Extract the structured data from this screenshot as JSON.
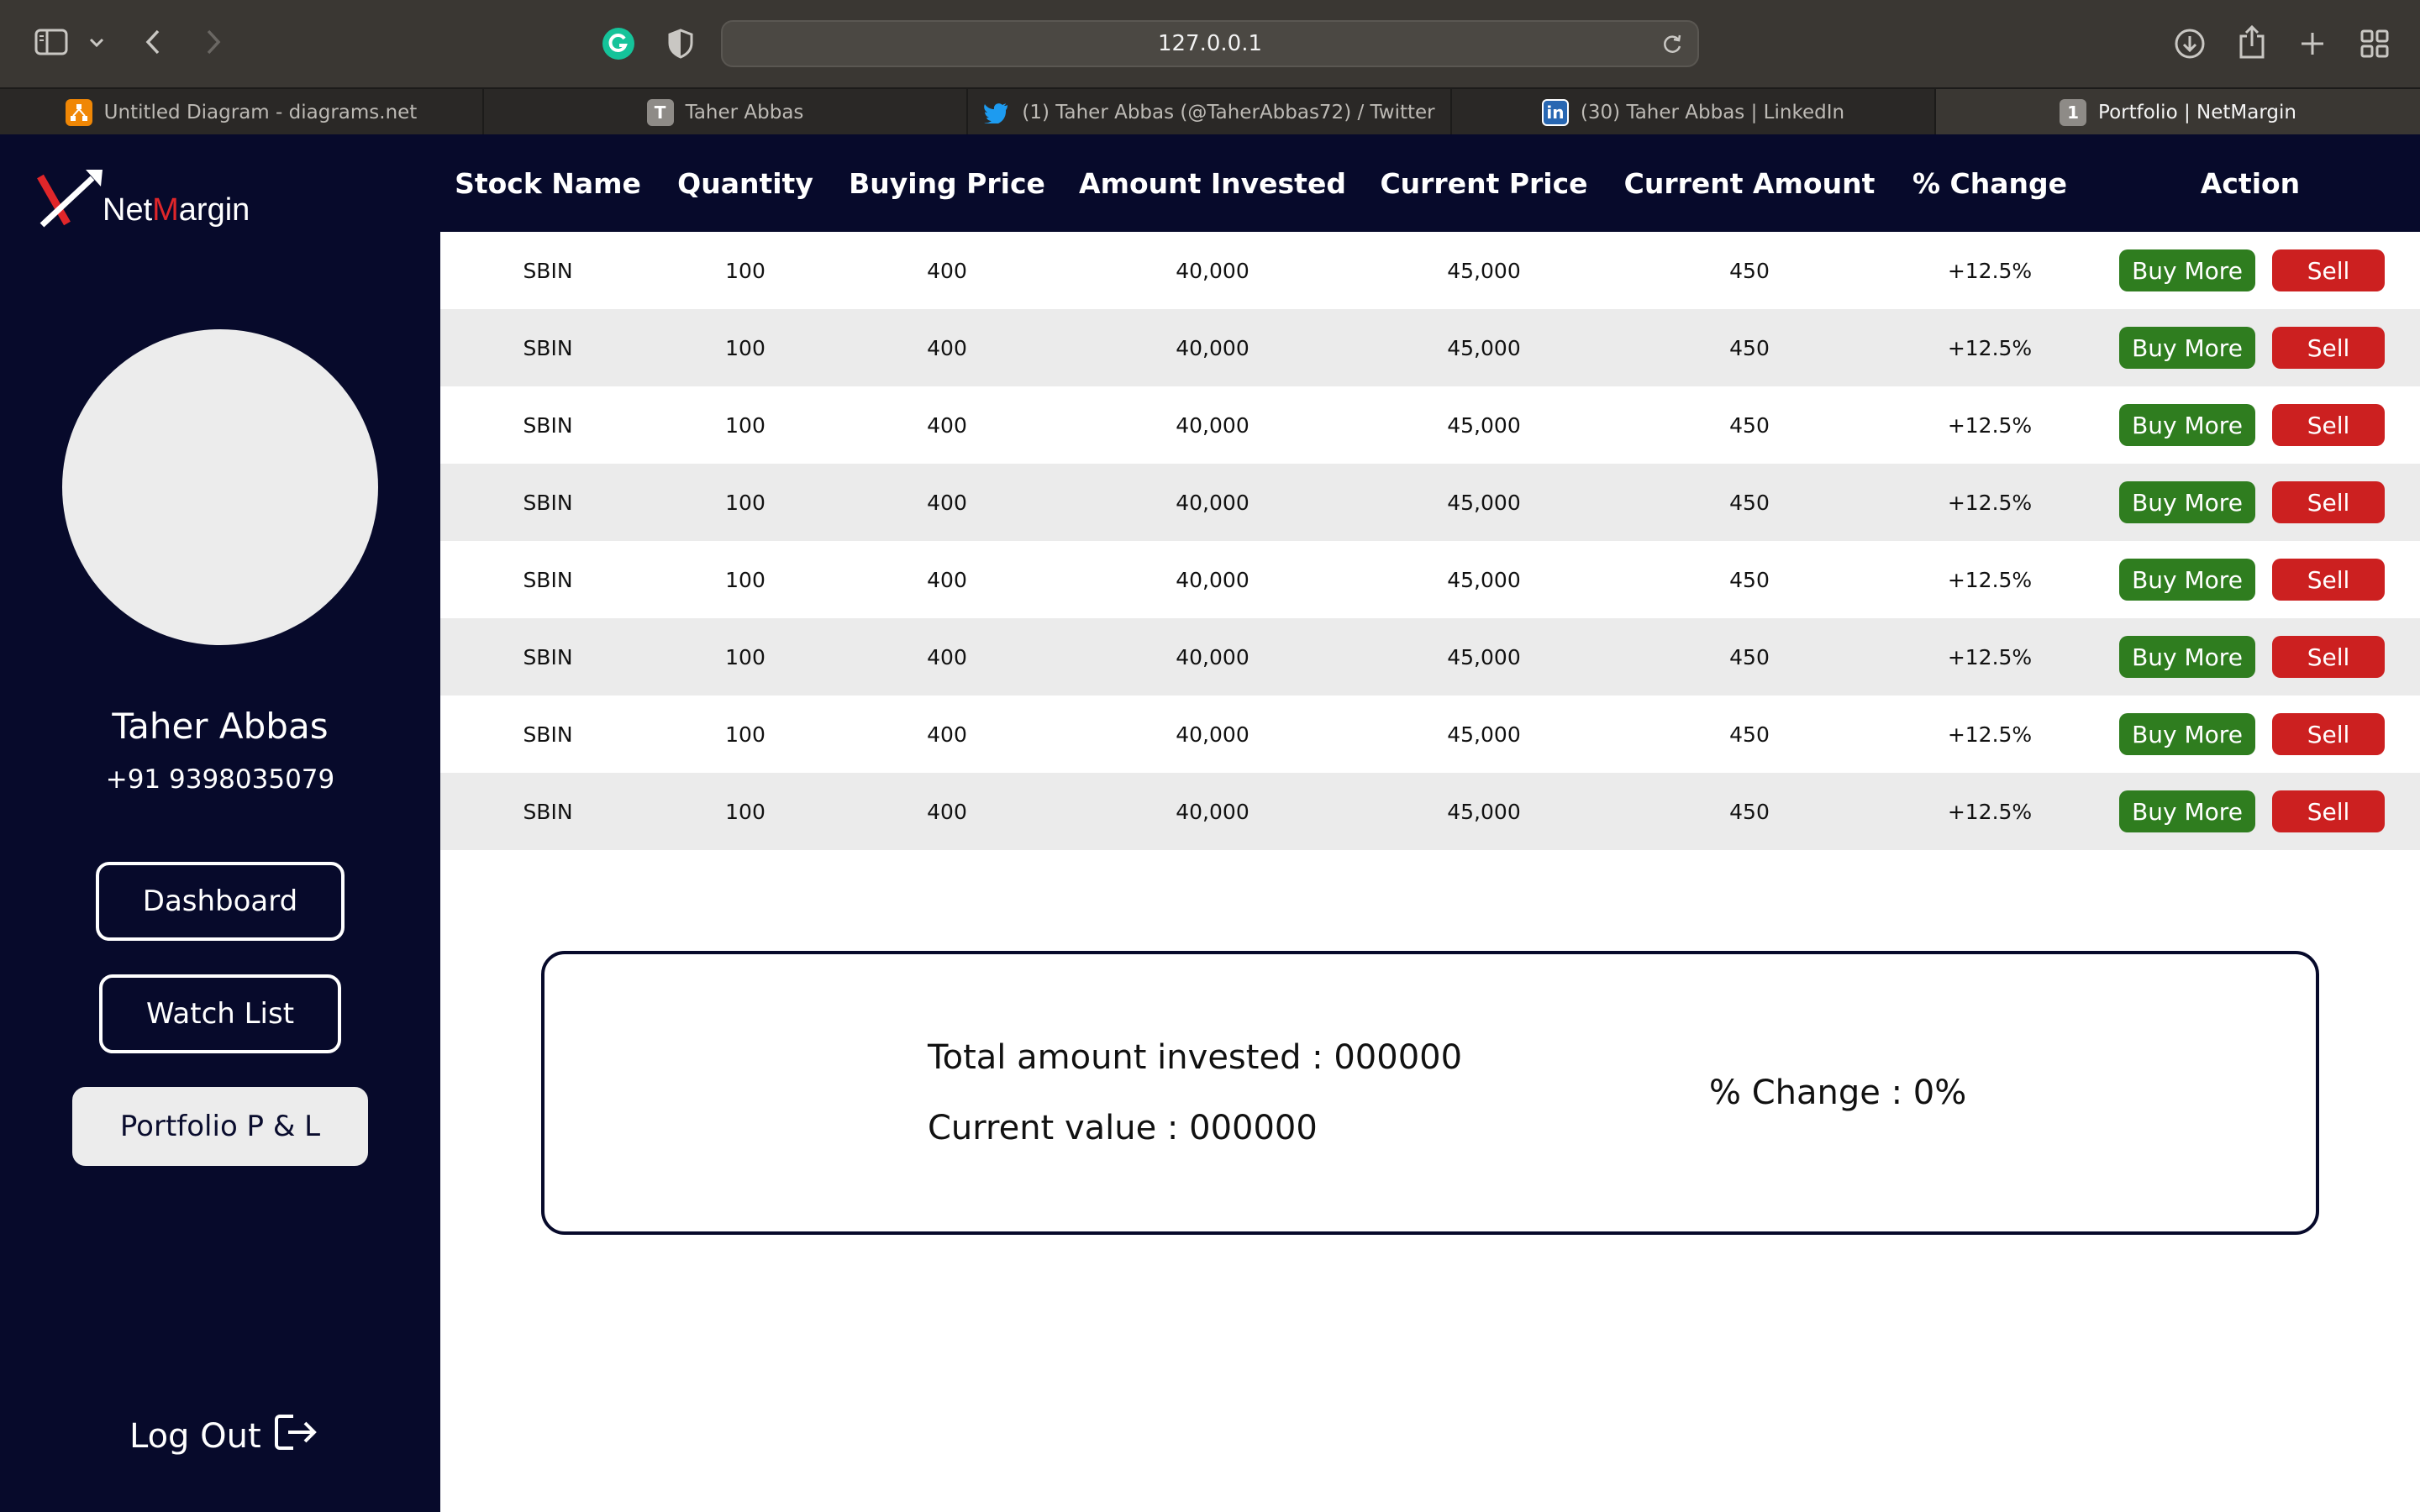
{
  "browser": {
    "url": "127.0.0.1",
    "tabs": [
      {
        "title": "Untitled Diagram - diagrams.net",
        "icon": "diagrams-favicon",
        "active": false
      },
      {
        "title": "Taher Abbas",
        "icon": "letter-t-favicon",
        "active": false
      },
      {
        "title": "(1) Taher Abbas (@TaherAbbas72) / Twitter",
        "icon": "twitter-bird-favicon",
        "active": false
      },
      {
        "title": "(30) Taher Abbas | LinkedIn",
        "icon": "linkedin-favicon",
        "active": false
      },
      {
        "title": "Portfolio | NetMargin",
        "icon": "number-1-favicon",
        "active": true
      }
    ]
  },
  "brand": {
    "name_prefix": "Net",
    "name_highlight": "M",
    "name_suffix": "argin",
    "accent": "#e0262a"
  },
  "user": {
    "name": "Taher Abbas",
    "phone": "+91 9398035079"
  },
  "nav": {
    "dashboard": "Dashboard",
    "watchlist": "Watch List",
    "portfolio": "Portfolio P & L",
    "logout": "Log Out"
  },
  "table": {
    "headers": [
      "Stock Name",
      "Quantity",
      "Buying Price",
      "Amount Invested",
      "Current Price",
      "Current Amount",
      "% Change",
      "Action"
    ],
    "rows": [
      [
        "SBIN",
        "100",
        "400",
        "40,000",
        "45,000",
        "450",
        "+12.5%"
      ],
      [
        "SBIN",
        "100",
        "400",
        "40,000",
        "45,000",
        "450",
        "+12.5%"
      ],
      [
        "SBIN",
        "100",
        "400",
        "40,000",
        "45,000",
        "450",
        "+12.5%"
      ],
      [
        "SBIN",
        "100",
        "400",
        "40,000",
        "45,000",
        "450",
        "+12.5%"
      ],
      [
        "SBIN",
        "100",
        "400",
        "40,000",
        "45,000",
        "450",
        "+12.5%"
      ],
      [
        "SBIN",
        "100",
        "400",
        "40,000",
        "45,000",
        "450",
        "+12.5%"
      ],
      [
        "SBIN",
        "100",
        "400",
        "40,000",
        "45,000",
        "450",
        "+12.5%"
      ],
      [
        "SBIN",
        "100",
        "400",
        "40,000",
        "45,000",
        "450",
        "+12.5%"
      ]
    ],
    "buy_label": "Buy More",
    "sell_label": "Sell"
  },
  "summary": {
    "total_invested": "Total amount invested : 000000",
    "current_value": "Current value : 000000",
    "change": "% Change : 0%"
  },
  "colors": {
    "navy": "#070a2b",
    "buy": "#2f7d1f",
    "sell": "#cc2020",
    "row_alt": "#ebebeb"
  }
}
